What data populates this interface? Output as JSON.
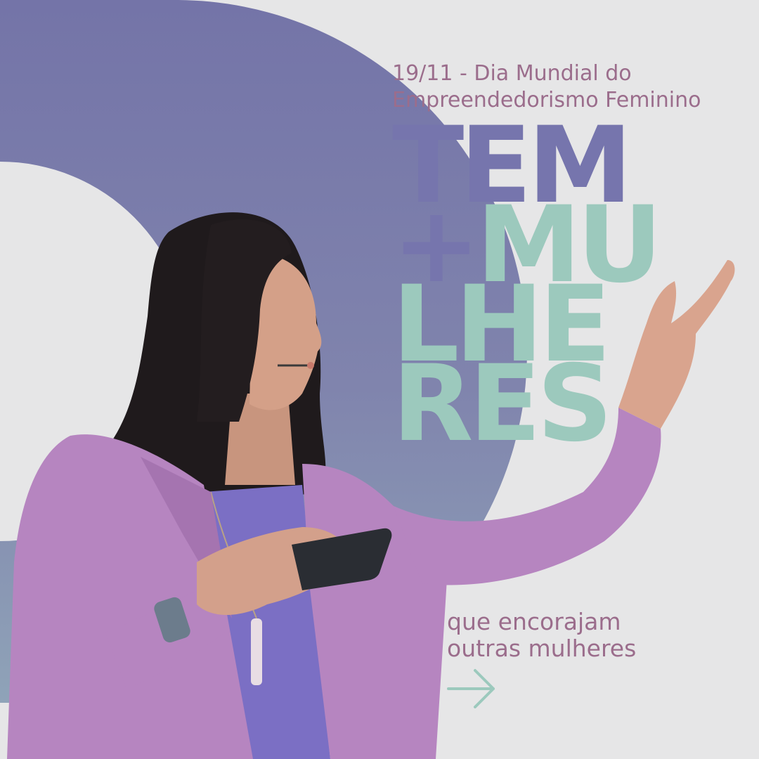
{
  "post": {
    "subtitle_line1": "19/11 - Dia Mundial do",
    "subtitle_line2": "Empreendedorismo Feminino",
    "headline": {
      "word1": "TEM",
      "plus": "+",
      "line2": "MU",
      "line3": "LHE",
      "line4": "RES"
    },
    "tagline_line1": "que encorajam",
    "tagline_line2": "outras mulheres"
  },
  "colors": {
    "background": "#e6e6e7",
    "arc_top": "#7474a8",
    "arc_bottom": "#8fa3b8",
    "headline_purple": "#7675ad",
    "headline_mint": "#9cc9bd",
    "text_mauve": "#9b6d8c",
    "blazer": "#b685c0",
    "blouse": "#7b6fc4",
    "arrow": "#9cc9bd"
  },
  "icons": {
    "next": "arrow-right-icon"
  }
}
